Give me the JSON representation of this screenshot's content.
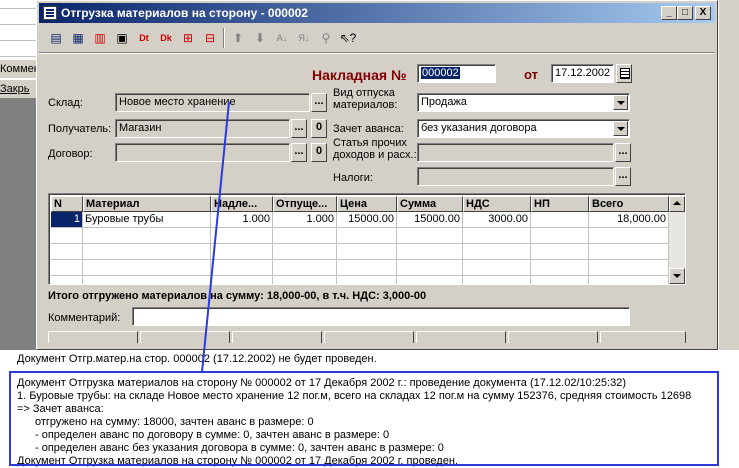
{
  "background": {
    "left_buttons": [
      "Коммен",
      "Закрь"
    ]
  },
  "window": {
    "title": "Отгрузка материалов на сторону - 000002",
    "title_buttons": {
      "minimize": "_",
      "maximize": "□",
      "close": "X"
    },
    "toolbar_icons": [
      "new-row-icon",
      "copy-row-icon",
      "delete-row-icon",
      "edit-row-icon",
      "dt-icon",
      "dk-icon",
      "add-doc-icon",
      "insert-icon",
      "move-up-icon",
      "move-down-icon",
      "sort-asc-icon",
      "sort-desc-icon",
      "filter-icon",
      "help-pointer-icon"
    ]
  },
  "header": {
    "invoice_label": "Накладная №",
    "invoice_number": "000002",
    "date_label": "от",
    "date_value": "17.12.2002"
  },
  "form": {
    "warehouse_label": "Склад:",
    "warehouse_value": "Новое место хранение",
    "recipient_label": "Получатель:",
    "recipient_value": "Магазин",
    "contract_label": "Договор:",
    "contract_value": "",
    "release_type_label_1": "Вид отпуска",
    "release_type_label_2": "материалов:",
    "release_type_value": "Продажа",
    "advance_label": "Зачет аванса:",
    "advance_value": "без указания договора",
    "other_income_label_1": "Статья прочих",
    "other_income_label_2": "доходов и расх.:",
    "other_income_value": "",
    "taxes_label": "Налоги:",
    "taxes_value": "",
    "dots": "...",
    "zero": "0"
  },
  "table": {
    "columns": [
      "N",
      "Материал",
      "Надле...",
      "Отпуще...",
      "Цена",
      "Сумма",
      "НДС",
      "НП",
      "Всего"
    ],
    "rows": [
      {
        "n": "1",
        "material": "Буровые трубы",
        "due": "1.000",
        "released": "1.000",
        "price": "15000.00",
        "sum": "15000.00",
        "vat": "3000.00",
        "np": "",
        "total": "18,000.00"
      }
    ]
  },
  "summary": {
    "total_text": "Итого отгружено материалов на сумму: 18,000-00, в т.ч. НДС: 3,000-00",
    "comment_label": "Комментарий:",
    "comment_value": ""
  },
  "messages": {
    "line1": "Документ Отгр.матер.на стор. 000002 (17.12.2002) не будет проведен.",
    "line2": "Документ Отгрузка материалов на сторону № 000002 от 17 Декабря 2002 г.: проведение документа (17.12.02/10:25:32)",
    "line3": "1. Буровые трубы: на складе Новое место хранение 12 пог.м, всего на складах 12 пог.м на сумму 152376,  средняя стоимость 12698",
    "line4": "=> Зачет аванса:",
    "line5": "отгружено на сумму: 18000, зачтен аванс в размере: 0",
    "line6": "- определен аванс по договору  в сумме: 0, зачтен аванс в размере: 0",
    "line7": "- определен аванс без указания договора в сумме: 0, зачтен аванс в размере: 0",
    "line8": "Документ Отгрузка материалов на сторону № 000002 от 17 Декабря 2002 г. проведен."
  },
  "colors": {
    "title_bar_start": "#0a246a",
    "invoice_label": "#800000",
    "annotation_blue": "#2a3adb"
  }
}
